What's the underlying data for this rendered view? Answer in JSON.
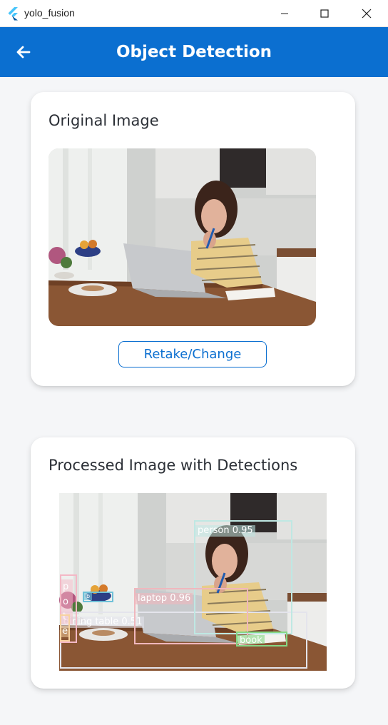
{
  "window": {
    "title": "yolo_fusion",
    "controls": [
      "minimize",
      "maximize",
      "close"
    ]
  },
  "appbar": {
    "title": "Object Detection",
    "back_icon": "arrow-left-icon"
  },
  "original_card": {
    "title": "Original Image",
    "button_label": "Retake/Change"
  },
  "processed_card": {
    "title": "Processed Image with Detections",
    "detections": [
      {
        "label": "person 0.95",
        "color": "#bfe8e3"
      },
      {
        "label": "laptop 0.96",
        "color": "#f0b7bd"
      },
      {
        "label": "dining table 0.51",
        "color": "#e4e4ec"
      },
      {
        "label": "book",
        "color": "#86d886"
      },
      {
        "label": "p o t",
        "color": "#f4b8c6"
      },
      {
        "label": "b",
        "color": "#6fc1d8"
      },
      {
        "label": "e",
        "color": "#f7d2a0"
      }
    ]
  },
  "colors": {
    "accent": "#0b6fd0",
    "background": "#f5f6f8",
    "card": "#ffffff"
  }
}
